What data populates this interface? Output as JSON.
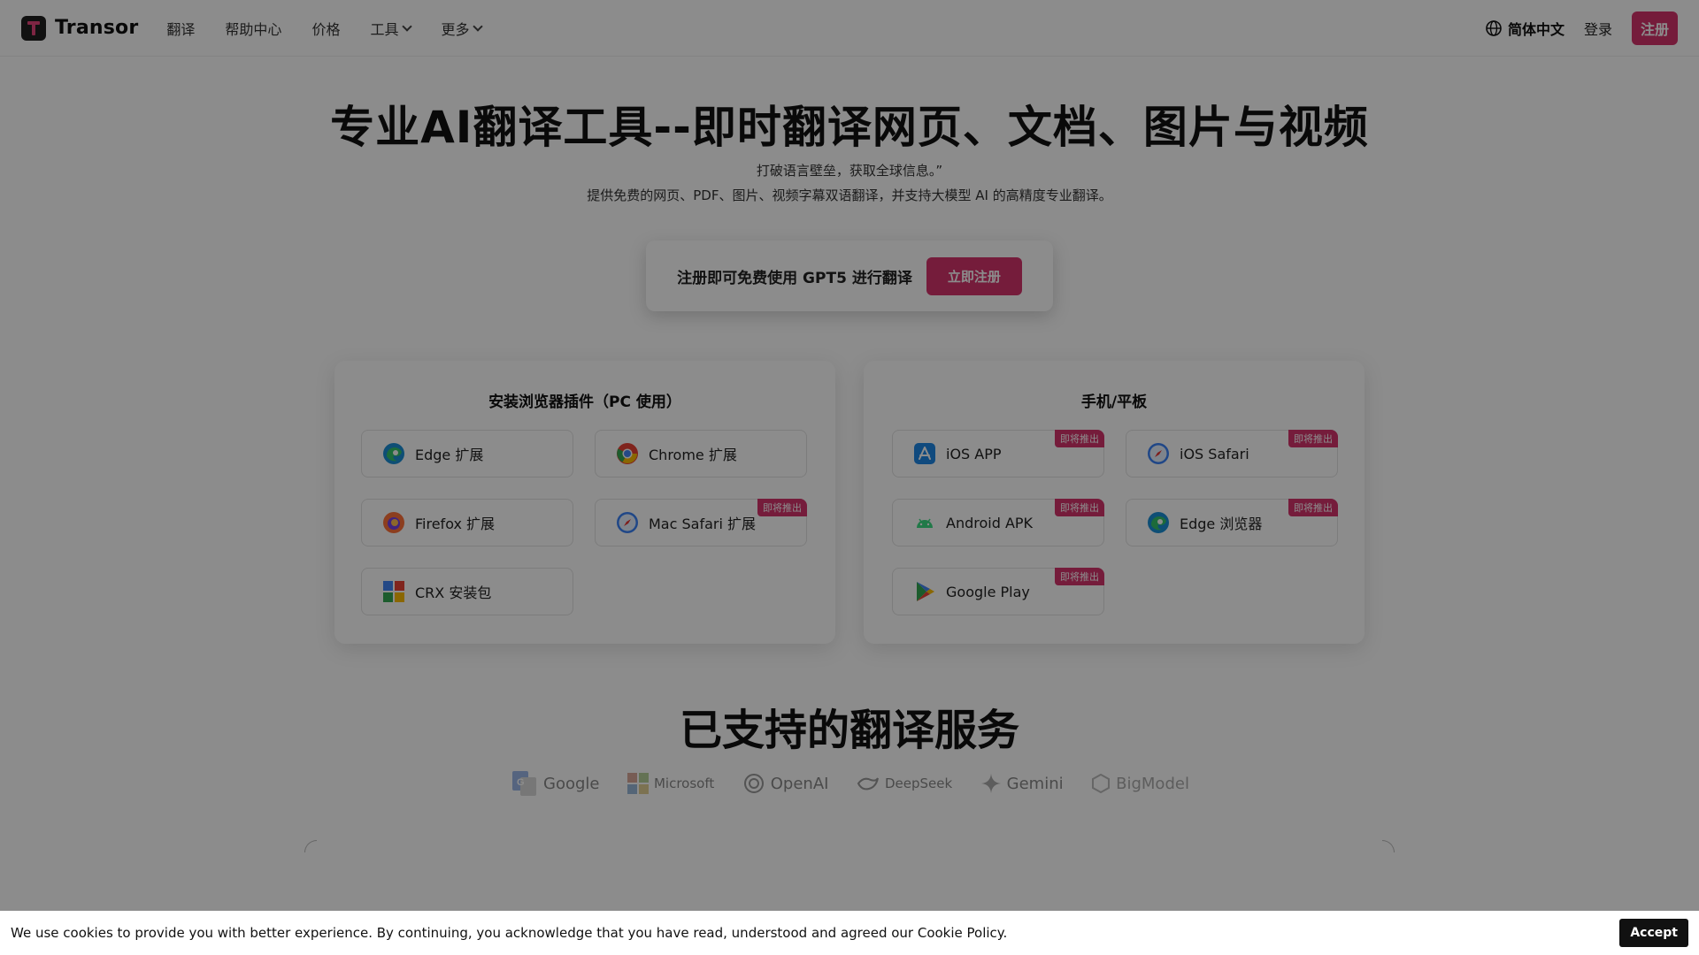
{
  "header": {
    "brand": "Transor",
    "nav": [
      {
        "label": "翻译",
        "dropdown": false
      },
      {
        "label": "帮助中心",
        "dropdown": false
      },
      {
        "label": "价格",
        "dropdown": false
      },
      {
        "label": "工具",
        "dropdown": true
      },
      {
        "label": "更多",
        "dropdown": true
      }
    ],
    "language": "简体中文",
    "login": "登录",
    "signup": "注册"
  },
  "hero": {
    "title": "专业AI翻译工具--即时翻译网页、文档、图片与视频",
    "subtitle1": "打破语言壁垒，获取全球信息。”",
    "subtitle2": "提供免费的网页、PDF、图片、视频字幕双语翻译，并支持大模型 AI 的高精度专业翻译。",
    "promo_text": "注册即可免费使用 GPT5 进行翻译",
    "promo_button": "立即注册"
  },
  "browser_card": {
    "title": "安装浏览器插件（PC 使用）",
    "items": [
      {
        "label": "Edge 扩展",
        "icon": "edge-icon",
        "badge": ""
      },
      {
        "label": "Chrome 扩展",
        "icon": "chrome-icon",
        "badge": ""
      },
      {
        "label": "Firefox 扩展",
        "icon": "firefox-icon",
        "badge": ""
      },
      {
        "label": "Mac Safari 扩展",
        "icon": "safari-icon",
        "badge": "即将推出"
      },
      {
        "label": "CRX 安装包",
        "icon": "crx-package-icon",
        "badge": ""
      }
    ]
  },
  "mobile_card": {
    "title": "手机/平板",
    "items": [
      {
        "label": "iOS APP",
        "icon": "app-store-icon",
        "badge": "即将推出"
      },
      {
        "label": "iOS Safari",
        "icon": "safari-icon",
        "badge": "即将推出"
      },
      {
        "label": "Android APK",
        "icon": "android-icon",
        "badge": "即将推出"
      },
      {
        "label": "Edge 浏览器",
        "icon": "edge-icon",
        "badge": "即将推出"
      },
      {
        "label": "Google Play",
        "icon": "google-play-icon",
        "badge": "即将推出"
      }
    ]
  },
  "services": {
    "title": "已支持的翻译服务",
    "providers": [
      "Google",
      "Microsoft",
      "OpenAI",
      "DeepSeek",
      "Gemini",
      "BigModel"
    ]
  },
  "cookie": {
    "text": "We use cookies to provide you with better experience. By continuing, you acknowledge that you have read, understood and agreed our Cookie Policy.",
    "accept": "Accept"
  },
  "colors": {
    "accent": "#d6336c",
    "overlay": "rgba(0,0,0,0.45)"
  }
}
